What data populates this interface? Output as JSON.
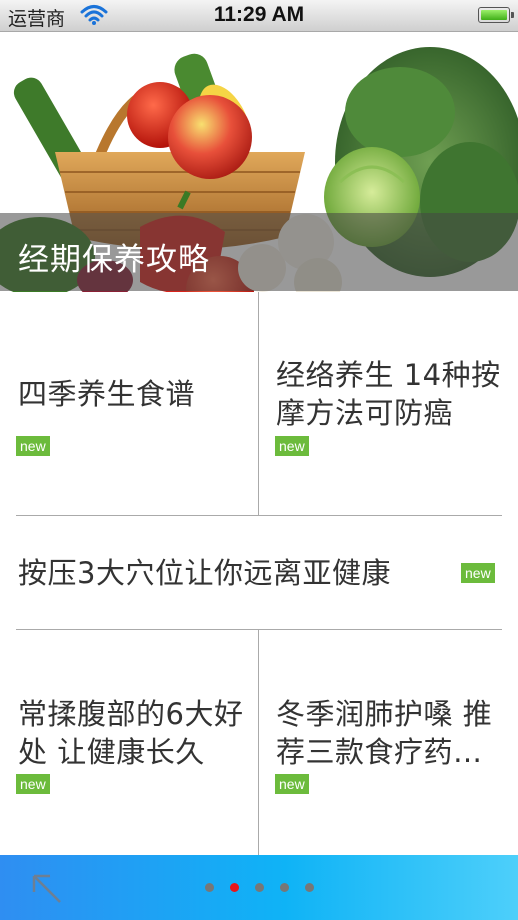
{
  "status_bar": {
    "carrier": "运营商",
    "time": "11:29 AM",
    "battery_level": 1.0
  },
  "banner": {
    "title": "经期保养攻略"
  },
  "articles": [
    {
      "title": "四季养生食谱",
      "badge": "new"
    },
    {
      "title": "经络养生 14种按摩方法可防癌",
      "badge": "new"
    },
    {
      "title": "按压3大穴位让你远离亚健康",
      "badge": "new"
    },
    {
      "title": "常揉腹部的6大好处 让健康长久",
      "badge": "new"
    },
    {
      "title": "冬季润肺护嗓 推荐三款食疗药…",
      "badge": "new"
    }
  ],
  "pager": {
    "total": 5,
    "active_index": 1
  },
  "icons": {
    "back": "arrow-up-left-icon",
    "wifi": "wifi-icon",
    "battery": "battery-icon"
  },
  "colors": {
    "badge": "#6cbb3c",
    "active_dot": "#e8151a",
    "bottom_bar": "#0fb3f6"
  }
}
